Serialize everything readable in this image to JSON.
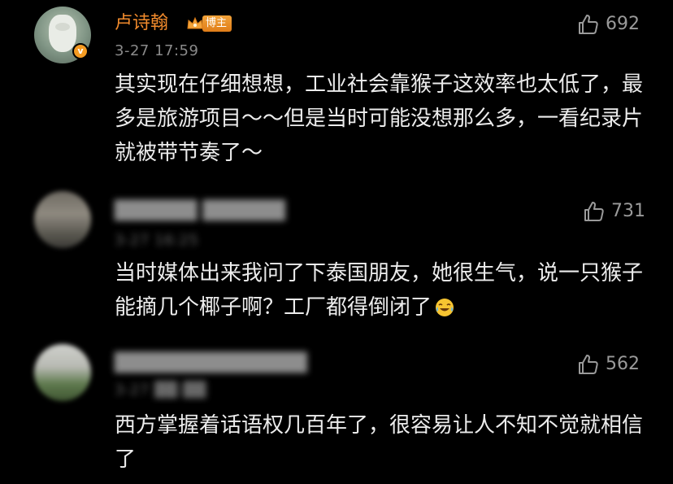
{
  "comments": [
    {
      "username": "卢诗翰",
      "badge_label": "博主",
      "verified_mark": "v",
      "timestamp": "3-27 17:59",
      "likes": "692",
      "text": "其实现在仔细想想，工业社会靠猴子这效率也太低了，最多是旅游项目～～但是当时可能没想那么多，一看纪录片就被带节奏了～",
      "avatar_icon": "moomin-avatar",
      "name_color": "#f08a2c"
    },
    {
      "username": "██████ ██████",
      "timestamp": "3-27 16:25",
      "likes": "731",
      "text": "当时媒体出来我问了下泰国朋友，她很生气，说一只猴子能摘几个椰子啊？工厂都得倒闭了",
      "trailing_icon": "laughing-crying-emoji"
    },
    {
      "username": "██████████████",
      "timestamp": "3-27 ██:██",
      "likes": "562",
      "text": "西方掌握着话语权几百年了，很容易让人不知不觉就相信了"
    }
  ],
  "colors": {
    "background": "#000000",
    "text": "#ececec",
    "muted": "#8a8a8a",
    "accent_orange": "#f08a2c"
  }
}
